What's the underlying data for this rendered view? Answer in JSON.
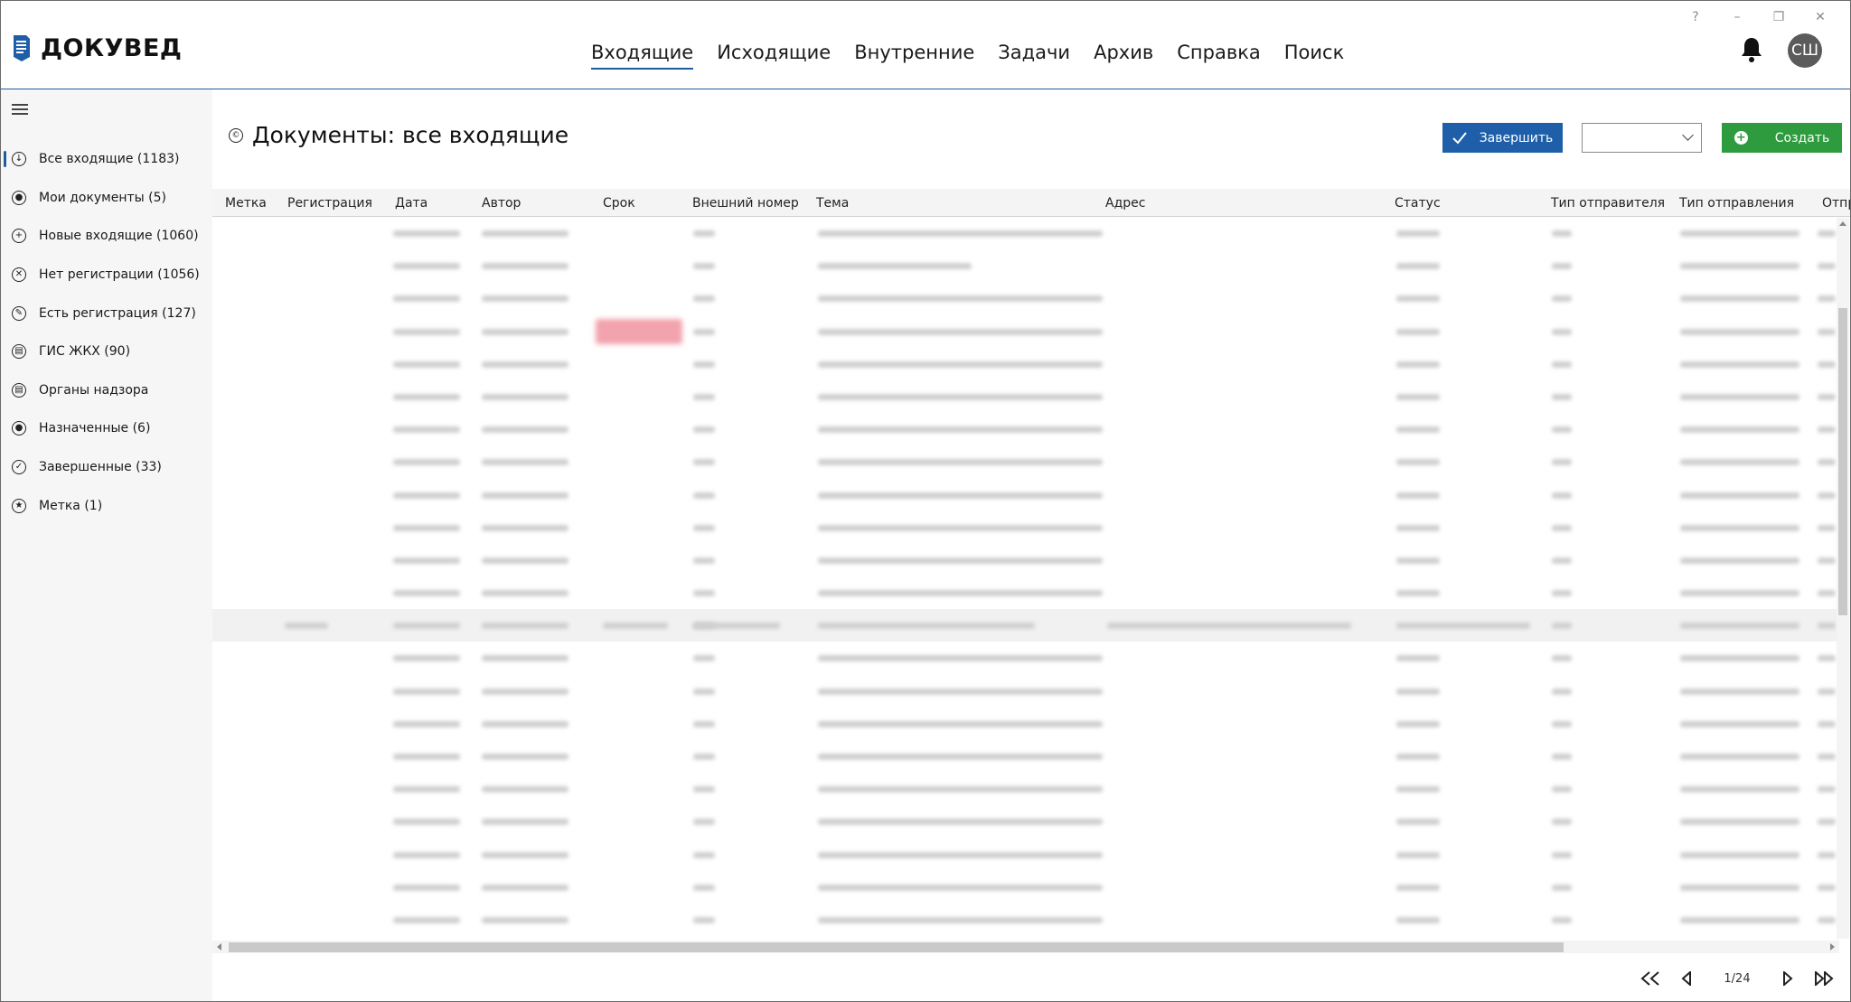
{
  "window_controls": {
    "help": "?",
    "minimize": "–",
    "restore": "❐",
    "close": "✕"
  },
  "app": {
    "name": "ДОКУВЕД",
    "user_initials": "СШ"
  },
  "topnav": [
    {
      "label": "Входящие",
      "active": true
    },
    {
      "label": "Исходящие",
      "active": false
    },
    {
      "label": "Внутренние",
      "active": false
    },
    {
      "label": "Задачи",
      "active": false
    },
    {
      "label": "Архив",
      "active": false
    },
    {
      "label": "Справка",
      "active": false
    },
    {
      "label": "Поиск",
      "active": false
    }
  ],
  "sidebar": {
    "items": [
      {
        "label": "Все входящие (1183)",
        "icon": "arrow-down-circle-icon",
        "active": true
      },
      {
        "label": "Мои документы (5)",
        "icon": "user-circle-icon"
      },
      {
        "label": "Новые входящие (1060)",
        "icon": "plus-circle-icon"
      },
      {
        "label": "Нет регистрации (1056)",
        "icon": "x-circle-icon"
      },
      {
        "label": "Есть регистрация (127)",
        "icon": "pencil-circle-icon"
      },
      {
        "label": "ГИС ЖКХ (90)",
        "icon": "building-circle-icon"
      },
      {
        "label": "Органы надзора",
        "icon": "building-circle-icon"
      },
      {
        "label": "Назначенные (6)",
        "icon": "user-filled-circle-icon"
      },
      {
        "label": "Завершенные (33)",
        "icon": "check-circle-icon"
      },
      {
        "label": "Метка (1)",
        "icon": "star-circle-icon"
      }
    ]
  },
  "main": {
    "title": "Документы: все входящие",
    "finish_label": "Завершить",
    "create_label": "Создать"
  },
  "table": {
    "columns": [
      "Метка",
      "Регистрация",
      "Дата",
      "Автор",
      "Срок",
      "Внешний номер",
      "Тема",
      "Адрес",
      "Статус",
      "Тип отправителя",
      "Тип отправления",
      "Отпр"
    ],
    "row_count": 22,
    "highlighted_row": 12,
    "overdue_row": 3
  },
  "pager": {
    "text": "1/24"
  },
  "colors": {
    "accent": "#1f5ea8",
    "create": "#2e9b3e",
    "overdue": "#f2a3ad"
  }
}
